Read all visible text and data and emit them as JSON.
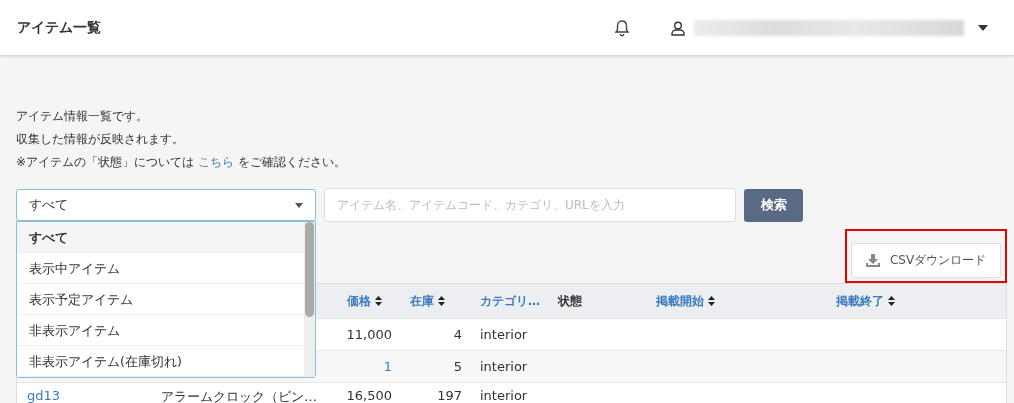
{
  "header": {
    "title": "アイテム一覧"
  },
  "intro": {
    "lines": [
      "アイテム情報一覧です。",
      "収集した情報が反映されます。"
    ],
    "note_before": "※アイテムの「状態」については",
    "note_link": "こちら",
    "note_after": "をご確認ください。"
  },
  "filter": {
    "value": "すべて",
    "expanded": true,
    "options": [
      {
        "label": "すべて",
        "selected": true
      },
      {
        "label": "表示中アイテム",
        "selected": false
      },
      {
        "label": "表示予定アイテム",
        "selected": false
      },
      {
        "label": "非表示アイテム",
        "selected": false
      },
      {
        "label": "非表示アイテム(在庫切れ)",
        "selected": false
      }
    ]
  },
  "search": {
    "placeholder": "アイテム名、アイテムコード、カテゴリ、URLを入力",
    "button": "検索"
  },
  "csv_button": {
    "label": "CSVダウンロード",
    "highlighted": true
  },
  "table": {
    "columns": [
      {
        "label": "価格",
        "sortable": true
      },
      {
        "label": "在庫",
        "sortable": true
      },
      {
        "label": "カテゴリ…",
        "sortable": false,
        "link": true
      },
      {
        "label": "状態",
        "sortable": false,
        "link": false
      },
      {
        "label": "掲載開始",
        "sortable": true
      },
      {
        "label": "掲載終了",
        "sortable": true
      }
    ],
    "rows": [
      {
        "cells": [
          "11,000",
          "4",
          "interior"
        ]
      },
      {
        "cells": [
          "1",
          "5",
          "interior"
        ],
        "price_link": true
      },
      {
        "code": "gd13",
        "name": "アラームクロック（ビン…",
        "cells": [
          "16,500",
          "197",
          "interior"
        ]
      }
    ]
  }
}
